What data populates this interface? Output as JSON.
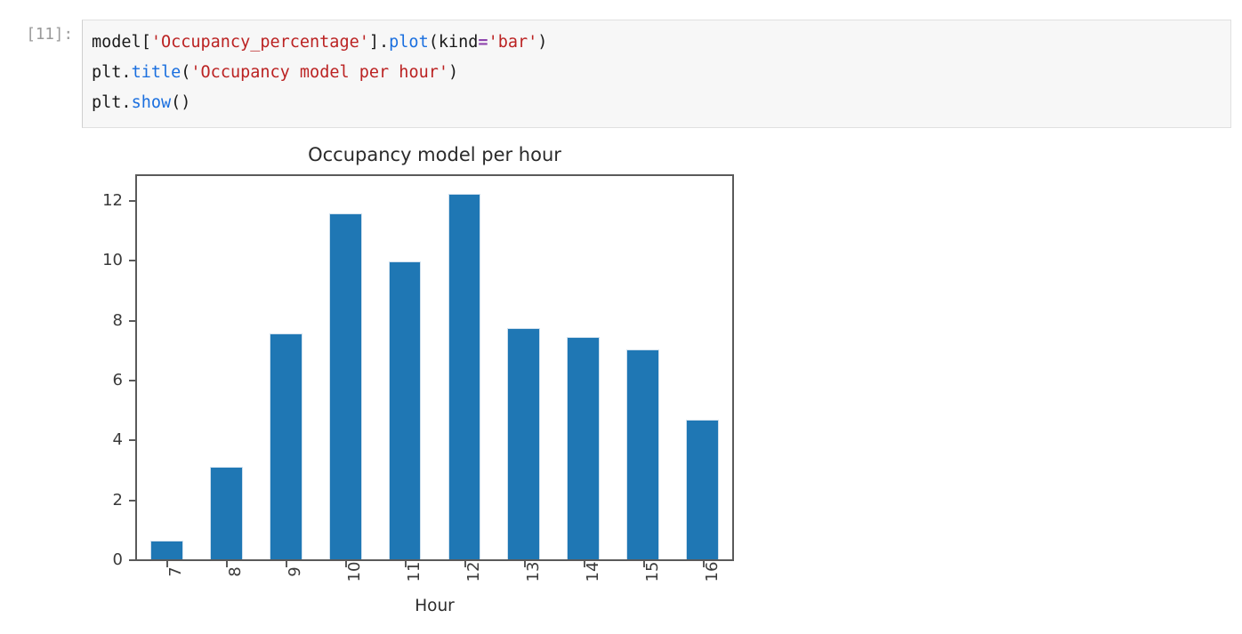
{
  "cell": {
    "prompt": "[11]:",
    "lines": [
      [
        {
          "t": "model[",
          "c": "plain"
        },
        {
          "t": "'Occupancy_percentage'",
          "c": "str"
        },
        {
          "t": "].",
          "c": "plain"
        },
        {
          "t": "plot",
          "c": "fn"
        },
        {
          "t": "(kind",
          "c": "plain"
        },
        {
          "t": "=",
          "c": "op"
        },
        {
          "t": "'bar'",
          "c": "str"
        },
        {
          "t": ")",
          "c": "plain"
        }
      ],
      [
        {
          "t": "plt.",
          "c": "plain"
        },
        {
          "t": "title",
          "c": "fn"
        },
        {
          "t": "(",
          "c": "plain"
        },
        {
          "t": "'Occupancy model per hour'",
          "c": "str"
        },
        {
          "t": ")",
          "c": "plain"
        }
      ],
      [
        {
          "t": "plt.",
          "c": "plain"
        },
        {
          "t": "show",
          "c": "fn"
        },
        {
          "t": "()",
          "c": "plain"
        }
      ]
    ]
  },
  "chart_data": {
    "type": "bar",
    "title": "Occupancy model per hour",
    "xlabel": "Hour",
    "ylabel": "",
    "categories": [
      "7",
      "8",
      "9",
      "10",
      "11",
      "12",
      "13",
      "14",
      "15",
      "16"
    ],
    "values": [
      0.62,
      3.08,
      7.55,
      11.55,
      9.95,
      12.2,
      7.72,
      7.42,
      7.0,
      4.65
    ],
    "yticks": [
      0,
      2,
      4,
      6,
      8,
      10,
      12
    ],
    "ylim": [
      0,
      12.8
    ],
    "grid": false,
    "legend": false,
    "bar_color": "#1f77b4",
    "bar_edge_color": "#cfe0ee",
    "axis_color": "#5a5a5a",
    "tick_rotation_deg": 90
  }
}
